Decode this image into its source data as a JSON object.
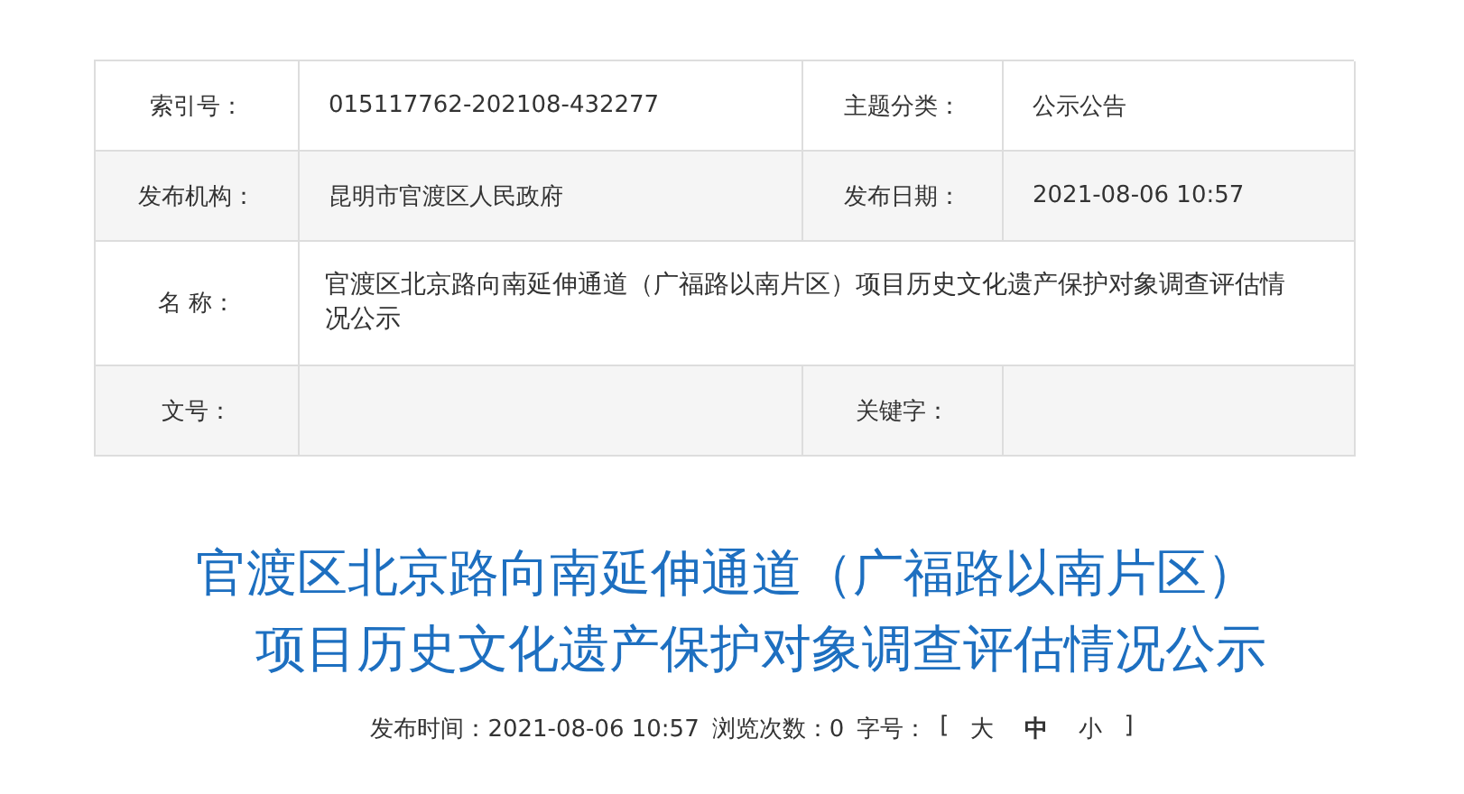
{
  "info_table": {
    "rows": [
      {
        "cells": [
          {
            "kind": "label",
            "text": "索引号："
          },
          {
            "kind": "value",
            "text": "015117762-202108-432277"
          },
          {
            "kind": "label",
            "text": "主题分类："
          },
          {
            "kind": "value",
            "text": "公示公告"
          }
        ]
      },
      {
        "cells": [
          {
            "kind": "label",
            "text": "发布机构："
          },
          {
            "kind": "value",
            "text": "昆明市官渡区人民政府"
          },
          {
            "kind": "label",
            "text": "发布日期："
          },
          {
            "kind": "value",
            "text": "2021-08-06 10:57"
          }
        ]
      },
      {
        "cells": [
          {
            "kind": "label",
            "text": "名 称："
          },
          {
            "kind": "wide",
            "text": "官渡区北京路向南延伸通道（广福路以南片区）项目历史文化遗产保护对象调查评估情况公示"
          }
        ]
      },
      {
        "cells": [
          {
            "kind": "label",
            "text": "文号："
          },
          {
            "kind": "value"
          },
          {
            "kind": "label",
            "text": "关键字："
          },
          {
            "kind": "value"
          }
        ]
      }
    ]
  },
  "article": {
    "title_lines": [
      "官渡区北京路向南延伸通道（广福路以南片区）",
      "项目历史文化遗产保护对象调查评估情况公示"
    ],
    "published": "发布时间：2021-08-06 10:57",
    "views": "浏览次数：0",
    "font_size_label": "字号：",
    "bracket_open": "[",
    "bracket_close": "]",
    "font_sizes": [
      {
        "label": "大",
        "selected": false
      },
      {
        "label": "中",
        "selected": true
      },
      {
        "label": "小",
        "selected": false
      }
    ]
  }
}
